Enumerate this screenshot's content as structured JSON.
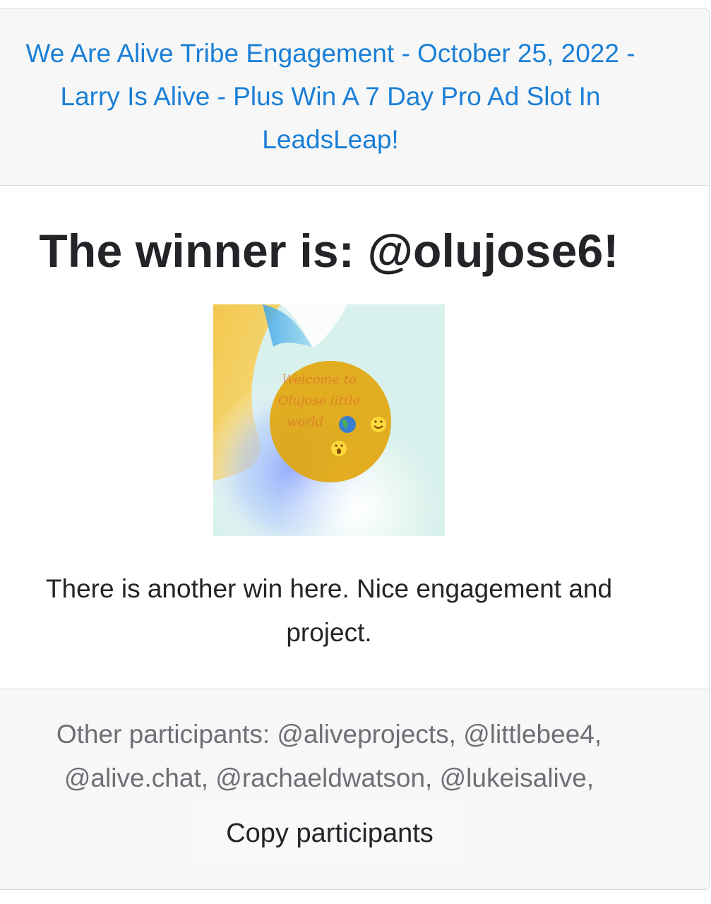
{
  "header": {
    "post_title": "We Are Alive Tribe Engagement - October 25, 2022 - Larry Is Alive - Plus Win A 7 Day Pro Ad Slot In LeadsLeap!"
  },
  "main": {
    "winner_text": "The winner is: @olujose6!",
    "avatar_caption": "Welcome to Olujose little world",
    "message": "There is another win here. Nice engagement and project."
  },
  "footer": {
    "participants_text": "Other participants: @aliveprojects, @littlebee4, @alive.chat, @rachaeldwatson, @lukeisalive,",
    "copy_button_label": "Copy participants"
  },
  "colors": {
    "link": "#1a7fd6",
    "header_bg": "#f7f7f7",
    "text": "#222428",
    "muted_text": "#6c6f75"
  }
}
